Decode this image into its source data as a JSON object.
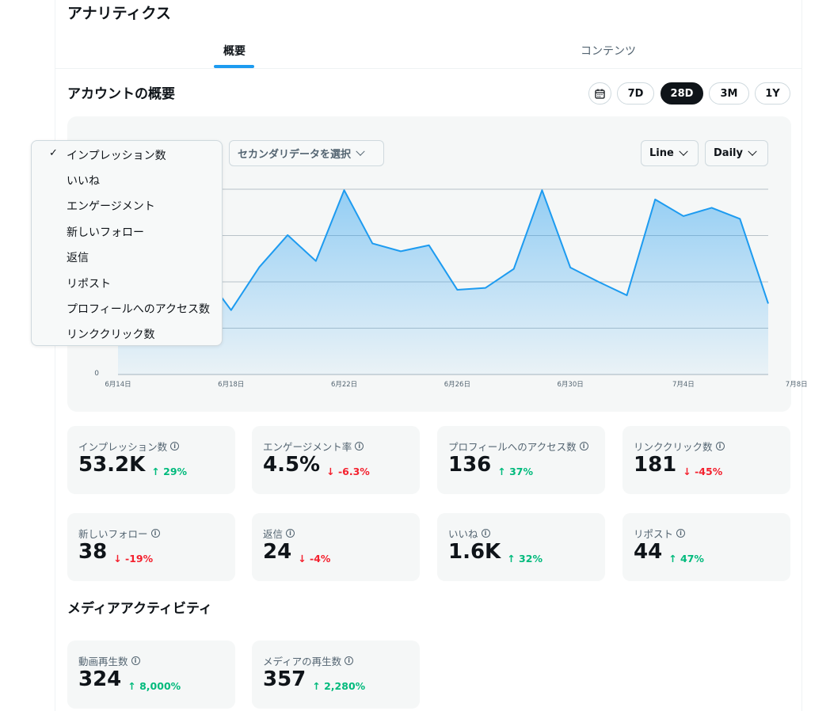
{
  "page": {
    "title": "アナリティクス"
  },
  "tabs": [
    {
      "label": "概要",
      "active": true
    },
    {
      "label": "コンテンツ",
      "active": false
    }
  ],
  "overview": {
    "title": "アカウントの概要",
    "ranges": [
      {
        "label": "calendar-icon",
        "icon": true
      },
      {
        "label": "7D"
      },
      {
        "label": "28D",
        "active": true
      },
      {
        "label": "3M"
      },
      {
        "label": "1Y"
      }
    ],
    "secondary_select": "セカンダリデータを選択",
    "chart_type_select": "Line",
    "granularity_select": "Daily"
  },
  "dropdown": {
    "selected_index": 0,
    "items": [
      "インプレッション数",
      "いいね",
      "エンゲージメント",
      "新しいフォロー",
      "返信",
      "リポスト",
      "プロフィールへのアクセス数",
      "リンククリック数"
    ]
  },
  "chart_data": {
    "type": "area",
    "series": [
      {
        "values": [
          1750,
          2240,
          3140,
          2210,
          1390,
          2320,
          3010,
          2450,
          3980,
          2830,
          2660,
          2790,
          1830,
          1870,
          2280,
          3980,
          2310,
          2000,
          1710,
          3780,
          3420,
          3600,
          3360,
          1530
        ]
      }
    ],
    "x_tick_labels": [
      "6月14日",
      "6月18日",
      "6月22日",
      "6月26日",
      "6月30日",
      "7月4日",
      "7月8日"
    ],
    "y_tick_labels": [
      "0"
    ],
    "ylim": [
      0,
      4000
    ],
    "grid": true,
    "color": "#1d9bf0"
  },
  "metrics": [
    {
      "label": "インプレッション数",
      "value": "53.2K",
      "delta": "29%",
      "dir": "up"
    },
    {
      "label": "エンゲージメント率",
      "value": "4.5%",
      "delta": "-6.3%",
      "dir": "down"
    },
    {
      "label": "プロフィールへのアクセス数",
      "value": "136",
      "delta": "37%",
      "dir": "up"
    },
    {
      "label": "リンククリック数",
      "value": "181",
      "delta": "-45%",
      "dir": "down"
    },
    {
      "label": "新しいフォロー",
      "value": "38",
      "delta": "-19%",
      "dir": "down"
    },
    {
      "label": "返信",
      "value": "24",
      "delta": "-4%",
      "dir": "down"
    },
    {
      "label": "いいね",
      "value": "1.6K",
      "delta": "32%",
      "dir": "up"
    },
    {
      "label": "リポスト",
      "value": "44",
      "delta": "47%",
      "dir": "up"
    }
  ],
  "media": {
    "title": "メディアアクティビティ",
    "metrics": [
      {
        "label": "動画再生数",
        "value": "324",
        "delta": "8,000%",
        "dir": "up"
      },
      {
        "label": "メディアの再生数",
        "value": "357",
        "delta": "2,280%",
        "dir": "up"
      }
    ]
  },
  "colors": {
    "accent": "#1d9bf0",
    "up": "#00ba7c",
    "down": "#f4212e"
  }
}
